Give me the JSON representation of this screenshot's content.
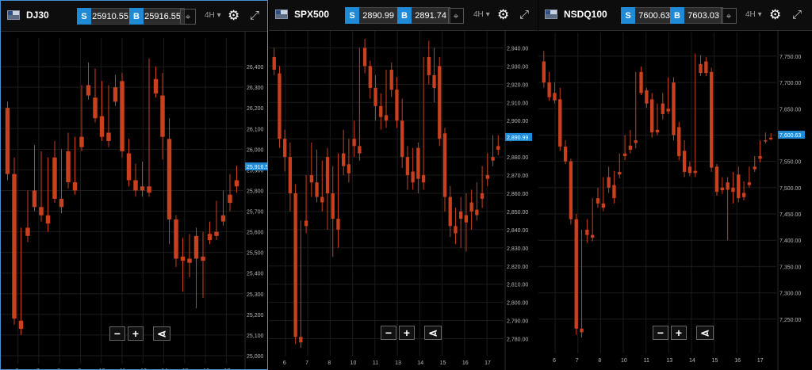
{
  "colors": {
    "bull": "#8cc47c",
    "bear": "#c9401f",
    "grid": "#1c1c1c",
    "axis_text": "#b8b8b8",
    "price_tag": "#1f8ad6"
  },
  "panels": [
    {
      "id": "dj30",
      "symbol": "DJ30",
      "sell_label": "S",
      "sell": "25910.55",
      "buy_label": "B",
      "buy": "25916.55",
      "interval": "4H",
      "current_price_label": "25,916.5",
      "chart_data": {
        "type": "candlestick",
        "ylim": [
          25000,
          26500
        ],
        "y_ticks": [
          "25,000",
          "25,100",
          "25,200",
          "25,300",
          "25,400",
          "25,500",
          "25,600",
          "25,700",
          "25,800",
          "25,900",
          "26,000",
          "26,100",
          "26,200",
          "26,300",
          "26,400"
        ],
        "x_ticks": [
          "6",
          "7",
          "8",
          "9",
          "10",
          "11",
          "13",
          "14",
          "15",
          "16",
          "17"
        ],
        "current": 25916.5,
        "candles": [
          [
            26200,
            26230,
            25880,
            25850
          ],
          [
            25880,
            25960,
            25180,
            25150
          ],
          [
            25170,
            25620,
            25130,
            25100
          ],
          [
            25620,
            25800,
            25580,
            25550
          ],
          [
            25800,
            26020,
            25720,
            25700
          ],
          [
            25720,
            25990,
            25680,
            25650
          ],
          [
            25680,
            25960,
            25640,
            25600
          ],
          [
            25960,
            26040,
            25760,
            25740
          ],
          [
            25760,
            26000,
            25720,
            25690
          ],
          [
            25990,
            26080,
            25840,
            25810
          ],
          [
            25840,
            26060,
            25800,
            25780
          ],
          [
            26060,
            26310,
            26010,
            25990
          ],
          [
            26310,
            26420,
            26260,
            26240
          ],
          [
            26250,
            26390,
            26150,
            26130
          ],
          [
            26160,
            26330,
            26060,
            26040
          ],
          [
            26080,
            26310,
            26040,
            26010
          ],
          [
            26300,
            26360,
            26230,
            26210
          ],
          [
            26330,
            26370,
            25990,
            25960
          ],
          [
            25980,
            26050,
            25850,
            25820
          ],
          [
            25850,
            25930,
            25800,
            25770
          ],
          [
            25820,
            25940,
            25800,
            25770
          ],
          [
            25820,
            26440,
            25790,
            25770
          ],
          [
            26340,
            26400,
            26270,
            26250
          ],
          [
            26260,
            26370,
            26060,
            25950
          ],
          [
            26050,
            26150,
            25660,
            25540
          ],
          [
            25660,
            25680,
            25470,
            25430
          ],
          [
            25480,
            25570,
            25460,
            25310
          ],
          [
            25470,
            25590,
            25450,
            25380
          ],
          [
            25580,
            25620,
            25470,
            25230
          ],
          [
            25480,
            25600,
            25460,
            25280
          ],
          [
            25590,
            25650,
            25560,
            25540
          ],
          [
            25600,
            25750,
            25580,
            25560
          ],
          [
            25680,
            25800,
            25650,
            25630
          ],
          [
            25780,
            25880,
            25740,
            25700
          ],
          [
            25850,
            25920,
            25820,
            25790
          ]
        ]
      }
    },
    {
      "id": "spx500",
      "symbol": "SPX500",
      "sell_label": "S",
      "sell": "2890.99",
      "buy_label": "B",
      "buy": "2891.74",
      "interval": "4H",
      "current_price_label": "2,890.99",
      "chart_data": {
        "type": "candlestick",
        "ylim": [
          2775,
          2945
        ],
        "y_ticks": [
          "2,780.00",
          "2,790.00",
          "2,800.00",
          "2,810.00",
          "2,820.00",
          "2,830.00",
          "2,840.00",
          "2,850.00",
          "2,860.00",
          "2,870.00",
          "2,880.00",
          "2,890.00",
          "2,900.00",
          "2,910.00",
          "2,920.00",
          "2,930.00",
          "2,940.00"
        ],
        "x_ticks": [
          "6",
          "7",
          "8",
          "10",
          "11",
          "13",
          "14",
          "15",
          "16",
          "17"
        ],
        "current": 2890.99,
        "candles": [
          [
            2935,
            2940,
            2928,
            2925
          ],
          [
            2926,
            2930,
            2890,
            2885
          ],
          [
            2890,
            2895,
            2880,
            2872
          ],
          [
            2880,
            2888,
            2860,
            2850
          ],
          [
            2860,
            2865,
            2781,
            2777
          ],
          [
            2781,
            2845,
            2778,
            2775
          ],
          [
            2845,
            2870,
            2842,
            2838
          ],
          [
            2870,
            2888,
            2866,
            2858
          ],
          [
            2866,
            2884,
            2858,
            2855
          ],
          [
            2858,
            2878,
            2855,
            2850
          ],
          [
            2880,
            2885,
            2860,
            2840
          ],
          [
            2860,
            2875,
            2846,
            2825
          ],
          [
            2846,
            2882,
            2840,
            2830
          ],
          [
            2882,
            2895,
            2875,
            2870
          ],
          [
            2876,
            2890,
            2871,
            2866
          ],
          [
            2890,
            2900,
            2886,
            2880
          ],
          [
            2886,
            2940,
            2882,
            2878
          ],
          [
            2940,
            2945,
            2930,
            2926
          ],
          [
            2930,
            2933,
            2918,
            2912
          ],
          [
            2918,
            2925,
            2908,
            2900
          ],
          [
            2908,
            2915,
            2902,
            2895
          ],
          [
            2903,
            2928,
            2900,
            2896
          ],
          [
            2928,
            2932,
            2917,
            2913
          ],
          [
            2917,
            2924,
            2900,
            2896
          ],
          [
            2900,
            2912,
            2880,
            2874
          ],
          [
            2880,
            2886,
            2870,
            2862
          ],
          [
            2872,
            2885,
            2866,
            2862
          ],
          [
            2885,
            2888,
            2868,
            2860
          ],
          [
            2870,
            2935,
            2866,
            2862
          ],
          [
            2935,
            2944,
            2925,
            2920
          ],
          [
            2925,
            2940,
            2918,
            2910
          ],
          [
            2930,
            2935,
            2890,
            2886
          ],
          [
            2893,
            2896,
            2858,
            2850
          ],
          [
            2858,
            2864,
            2842,
            2836
          ],
          [
            2842,
            2852,
            2838,
            2832
          ],
          [
            2850,
            2858,
            2846,
            2830
          ],
          [
            2848,
            2860,
            2844,
            2828
          ],
          [
            2855,
            2862,
            2850,
            2840
          ],
          [
            2851,
            2866,
            2848,
            2845
          ],
          [
            2860,
            2875,
            2857,
            2852
          ],
          [
            2870,
            2882,
            2868,
            2864
          ],
          [
            2880,
            2892,
            2878,
            2875
          ],
          [
            2886,
            2892,
            2884,
            2881
          ]
        ]
      }
    },
    {
      "id": "nsdq100",
      "symbol": "NSDQ100",
      "sell_label": "S",
      "sell": "7600.63",
      "buy_label": "B",
      "buy": "7603.03",
      "interval": "4H",
      "current_price_label": "7,600.63",
      "chart_data": {
        "type": "candlestick",
        "ylim": [
          7200,
          7780
        ],
        "y_ticks": [
          "7,250.00",
          "7,300.00",
          "7,350.00",
          "7,400.00",
          "7,450.00",
          "7,500.00",
          "7,550.00",
          "7,600.00",
          "7,650.00",
          "7,700.00",
          "7,750.00"
        ],
        "x_ticks": [
          "6",
          "7",
          "8",
          "10",
          "11",
          "13",
          "14",
          "15",
          "16",
          "17"
        ],
        "current": 7600.63,
        "candles": [
          [
            7740,
            7760,
            7700,
            7690
          ],
          [
            7700,
            7720,
            7672,
            7665
          ],
          [
            7680,
            7700,
            7666,
            7660
          ],
          [
            7668,
            7690,
            7578,
            7570
          ],
          [
            7578,
            7590,
            7550,
            7545
          ],
          [
            7550,
            7555,
            7440,
            7430
          ],
          [
            7440,
            7450,
            7232,
            7220
          ],
          [
            7232,
            7420,
            7225,
            7215
          ],
          [
            7420,
            7440,
            7410,
            7395
          ],
          [
            7410,
            7480,
            7405,
            7398
          ],
          [
            7480,
            7500,
            7470,
            7462
          ],
          [
            7470,
            7520,
            7462,
            7455
          ],
          [
            7520,
            7540,
            7500,
            7490
          ],
          [
            7505,
            7532,
            7480,
            7470
          ],
          [
            7530,
            7565,
            7525,
            7518
          ],
          [
            7565,
            7600,
            7560,
            7552
          ],
          [
            7580,
            7610,
            7572,
            7565
          ],
          [
            7590,
            7720,
            7585,
            7575
          ],
          [
            7720,
            7730,
            7680,
            7676
          ],
          [
            7685,
            7690,
            7660,
            7652
          ],
          [
            7668,
            7680,
            7605,
            7595
          ],
          [
            7610,
            7660,
            7605,
            7600
          ],
          [
            7660,
            7680,
            7640,
            7630
          ],
          [
            7650,
            7710,
            7645,
            7640
          ],
          [
            7700,
            7710,
            7600,
            7590
          ],
          [
            7615,
            7625,
            7560,
            7552
          ],
          [
            7570,
            7590,
            7530,
            7520
          ],
          [
            7540,
            7550,
            7528,
            7522
          ],
          [
            7532,
            7755,
            7528,
            7520
          ],
          [
            7735,
            7752,
            7718,
            7712
          ],
          [
            7740,
            7748,
            7718,
            7712
          ],
          [
            7720,
            7728,
            7538,
            7530
          ],
          [
            7540,
            7545,
            7492,
            7485
          ],
          [
            7500,
            7520,
            7495,
            7488
          ],
          [
            7510,
            7520,
            7496,
            7400
          ],
          [
            7500,
            7530,
            7492,
            7470
          ],
          [
            7525,
            7540,
            7480,
            7472
          ],
          [
            7490,
            7512,
            7482,
            7476
          ],
          [
            7510,
            7540,
            7505,
            7500
          ],
          [
            7540,
            7560,
            7535,
            7530
          ],
          [
            7560,
            7590,
            7555,
            7548
          ],
          [
            7590,
            7605,
            7588,
            7584
          ],
          [
            7595,
            7604,
            7592,
            7590
          ]
        ]
      }
    }
  ],
  "controls": {
    "zoom_out": "−",
    "zoom_in": "+"
  }
}
